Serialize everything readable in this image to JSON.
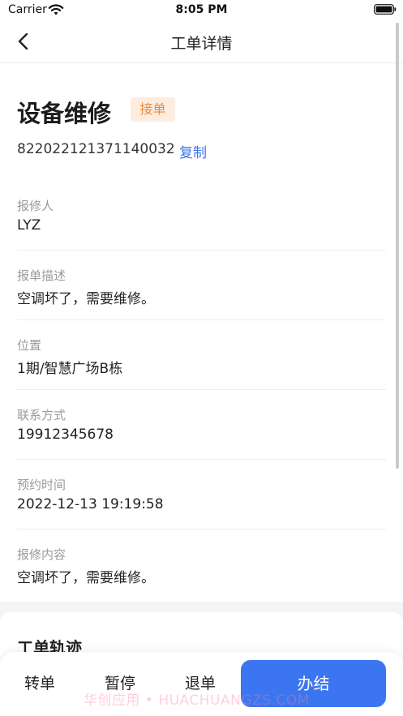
{
  "status_bar": {
    "carrier": "Carrier",
    "time": "8:05 PM"
  },
  "nav": {
    "title": "工单详情"
  },
  "order": {
    "title": "设备维修",
    "status": "接单",
    "number": "822022121371140032",
    "copy_label": "复制"
  },
  "fields": [
    {
      "label": "报修人",
      "value": "LYZ"
    },
    {
      "label": "报单描述",
      "value": "空调坏了，需要维修。"
    },
    {
      "label": "位置",
      "value": "1期/智慧广场B栋"
    },
    {
      "label": "联系方式",
      "value": "19912345678"
    },
    {
      "label": "预约时间",
      "value": "2022-12-13 19:19:58"
    },
    {
      "label": "报修内容",
      "value": "空调坏了，需要维修。"
    }
  ],
  "track": {
    "title": "工单轨迹"
  },
  "actions": {
    "transfer": "转单",
    "pause": "暂停",
    "return": "退单",
    "finish": "办结"
  },
  "watermark": "华创应用 • HUACHUANGZS.COM",
  "colors": {
    "accent": "#3b76f0",
    "badge_bg": "#fdece0",
    "badge_text": "#f08a2c",
    "link": "#3e74e8"
  }
}
